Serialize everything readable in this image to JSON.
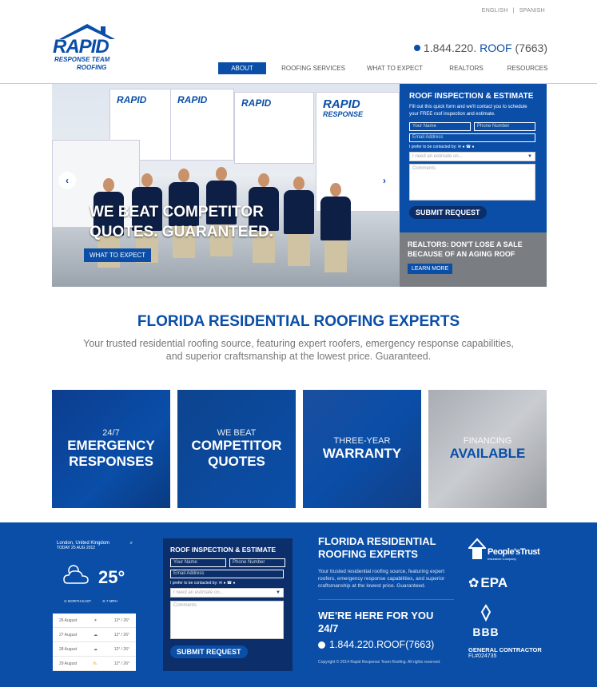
{
  "lang": {
    "english": "ENGLISH",
    "sep": "|",
    "spanish": "SPANISH"
  },
  "logo": {
    "line1": "RAPID",
    "line2": "RESPONSE TEAM",
    "line3": "ROOFING"
  },
  "phone": {
    "prefix": "1.844.220.",
    "word": "ROOF",
    "suffix": "(7663)"
  },
  "nav": [
    "ABOUT",
    "ROOFING SERVICES",
    "WHAT TO EXPECT",
    "REALTORS",
    "RESOURCES"
  ],
  "hero": {
    "line1": "WE BEAT COMPETITOR",
    "line2": "QUOTES. GUARANTEED.",
    "button": "WHAT TO EXPECT",
    "truck_label": "RAPID",
    "truck_sub": "RESPONSE"
  },
  "form": {
    "title": "ROOF INSPECTION & ESTIMATE",
    "intro": "Fill out this quick form and we'll contact you to schedule your FREE roof inspection and estimate.",
    "name": "Your Name",
    "phone": "Phone Number",
    "email": "Email Address",
    "contact_pref": "I prefer to be contacted by:",
    "estimate": "I need an estimate on...",
    "comments": "Comments",
    "submit": "SUBMIT REQUEST"
  },
  "realtors": {
    "heading": "REALTORS: DON'T LOSE A SALE BECAUSE OF AN AGING ROOF",
    "button": "LEARN MORE"
  },
  "main": {
    "title": "FLORIDA RESIDENTIAL ROOFING EXPERTS",
    "subtitle": "Your trusted residential roofing source, featuring expert roofers, emergency response capabilities, and superior craftsmanship at the lowest price. Guaranteed."
  },
  "tiles": [
    {
      "small": "24/7",
      "big1": "EMERGENCY",
      "big2": "RESPONSES"
    },
    {
      "small": "WE BEAT",
      "big1": "COMPETITOR",
      "big2": "QUOTES"
    },
    {
      "small": "THREE-YEAR",
      "big1": "WARRANTY",
      "big2": ""
    },
    {
      "small": "FINANCING",
      "big1": "AVAILABLE",
      "big2": ""
    }
  ],
  "weather": {
    "city": "London, United Kingdom",
    "date": "TODAY 25 AUG 2012",
    "temp": "25°",
    "wind_dir": "NORTH EAST",
    "wind_speed": "7 MPH",
    "days": [
      {
        "day": "26 August",
        "temp": "12° / 26°"
      },
      {
        "day": "27 August",
        "temp": "12° / 26°"
      },
      {
        "day": "28 August",
        "temp": "12° / 26°"
      },
      {
        "day": "29 August",
        "temp": "12° / 26°"
      }
    ]
  },
  "footer": {
    "title": "FLORIDA RESIDENTIAL ROOFING EXPERTS",
    "desc": "Your trusted residential roofing source, featuring expert roofers, emergency response capabilities, and superior craftsmanship at the lowest price. Guaranteed.",
    "here": "WE'RE HERE FOR YOU 24/7",
    "phone": "1.844.220.ROOF(7663)",
    "copyright": "Copyright © 2014 Rapid Response Team Roofing. All rights reserved.",
    "peoples": "People'sTrust",
    "peoples_sub": "Insurance Company",
    "epa": "EPA",
    "bbb": "BBB",
    "gc": "GENERAL CONTRACTOR",
    "license": "FL#024735"
  },
  "colors": {
    "brand": "#0a4ea8",
    "dark": "#0c2e6b",
    "gray": "#7a7d82"
  }
}
